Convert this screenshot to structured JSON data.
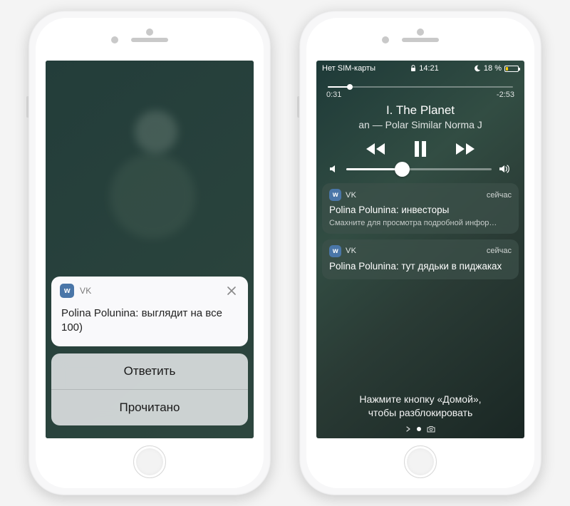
{
  "left": {
    "app_icon_text": "w",
    "app_name": "VK",
    "message": "Polina Polunina: выглядит на все 100)",
    "actions": {
      "reply": "Ответить",
      "mark_read": "Прочитано"
    }
  },
  "right": {
    "status": {
      "carrier": "Нет SIM-карты",
      "time": "14:21",
      "battery_pct": "18 %"
    },
    "player": {
      "elapsed": "0:31",
      "remaining": "-2:53",
      "title": "I. The Planet",
      "subtitle": "an — Polar Similar     Norma J",
      "progress_pct": 12,
      "volume_pct": 38
    },
    "notifications": [
      {
        "app_icon_text": "w",
        "app_name": "VK",
        "time": "сейчас",
        "body": "Polina Polunina: инвесторы",
        "hint": "Смахните для просмотра подробной инфор…"
      },
      {
        "app_icon_text": "w",
        "app_name": "VK",
        "time": "сейчас",
        "body": "Polina Polunina: тут дядьки в пиджаках"
      }
    ],
    "unlock_hint_line1": "Нажмите кнопку «Домой»,",
    "unlock_hint_line2": "чтобы разблокировать"
  }
}
